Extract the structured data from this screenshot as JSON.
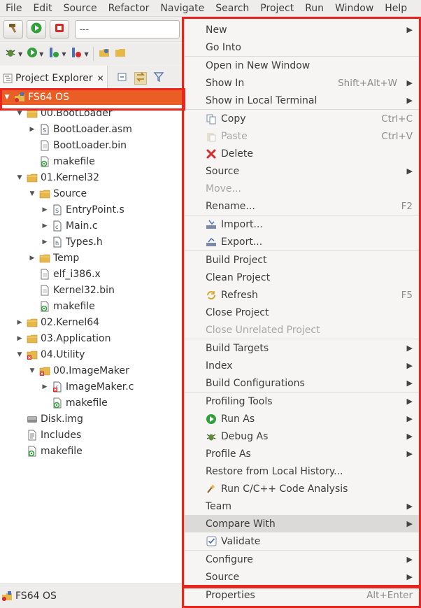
{
  "menubar": [
    "File",
    "Edit",
    "Source",
    "Refactor",
    "Navigate",
    "Search",
    "Project",
    "Run",
    "Window",
    "Help"
  ],
  "toolbar": {
    "config_combo": "---"
  },
  "explorer": {
    "tab_label": "Project Explorer",
    "tab_close": "✕",
    "tree": [
      {
        "label": "FS64 OS",
        "depth": 0,
        "toggle": "open",
        "icon": "project-icon",
        "selected": true
      },
      {
        "label": "00.BootLoader",
        "depth": 1,
        "toggle": "open",
        "icon": "folder-icon"
      },
      {
        "label": "BootLoader.asm",
        "depth": 2,
        "toggle": "closed",
        "icon": "asm-file-icon"
      },
      {
        "label": "BootLoader.bin",
        "depth": 2,
        "toggle": "none",
        "icon": "file-icon"
      },
      {
        "label": "makefile",
        "depth": 2,
        "toggle": "none",
        "icon": "makefile-icon"
      },
      {
        "label": "01.Kernel32",
        "depth": 1,
        "toggle": "open",
        "icon": "folder-icon"
      },
      {
        "label": "Source",
        "depth": 2,
        "toggle": "open",
        "icon": "folder-icon"
      },
      {
        "label": "EntryPoint.s",
        "depth": 3,
        "toggle": "closed",
        "icon": "asm-file-icon"
      },
      {
        "label": "Main.c",
        "depth": 3,
        "toggle": "closed",
        "icon": "c-file-icon"
      },
      {
        "label": "Types.h",
        "depth": 3,
        "toggle": "closed",
        "icon": "h-file-icon"
      },
      {
        "label": "Temp",
        "depth": 2,
        "toggle": "closed",
        "icon": "folder-icon"
      },
      {
        "label": "elf_i386.x",
        "depth": 2,
        "toggle": "none",
        "icon": "file-icon"
      },
      {
        "label": "Kernel32.bin",
        "depth": 2,
        "toggle": "none",
        "icon": "file-icon"
      },
      {
        "label": "makefile",
        "depth": 2,
        "toggle": "none",
        "icon": "makefile-icon"
      },
      {
        "label": "02.Kernel64",
        "depth": 1,
        "toggle": "closed",
        "icon": "folder-icon"
      },
      {
        "label": "03.Application",
        "depth": 1,
        "toggle": "closed",
        "icon": "folder-icon"
      },
      {
        "label": "04.Utility",
        "depth": 1,
        "toggle": "open",
        "icon": "folder-error-icon"
      },
      {
        "label": "00.ImageMaker",
        "depth": 2,
        "toggle": "open",
        "icon": "folder-error-icon"
      },
      {
        "label": "ImageMaker.c",
        "depth": 3,
        "toggle": "closed",
        "icon": "c-file-error-icon"
      },
      {
        "label": "makefile",
        "depth": 3,
        "toggle": "none",
        "icon": "makefile-icon"
      },
      {
        "label": "Disk.img",
        "depth": 1,
        "toggle": "none",
        "icon": "disk-icon"
      },
      {
        "label": "Includes",
        "depth": 1,
        "toggle": "none",
        "icon": "includes-icon"
      },
      {
        "label": "makefile",
        "depth": 1,
        "toggle": "none",
        "icon": "makefile-icon"
      }
    ]
  },
  "status": {
    "label": "FS64 OS"
  },
  "context_menu": {
    "items": [
      {
        "label": "New",
        "submenu": true
      },
      {
        "label": "Go Into"
      },
      {
        "sep": true
      },
      {
        "label": "Open in New Window"
      },
      {
        "label": "Show In",
        "shortcut": "Shift+Alt+W",
        "submenu": true
      },
      {
        "label": "Show in Local Terminal",
        "submenu": true
      },
      {
        "sep": true
      },
      {
        "label": "Copy",
        "shortcut": "Ctrl+C",
        "icon": "copy-icon"
      },
      {
        "label": "Paste",
        "shortcut": "Ctrl+V",
        "icon": "paste-icon",
        "disabled": true
      },
      {
        "label": "Delete",
        "icon": "delete-icon"
      },
      {
        "label": "Source",
        "submenu": true
      },
      {
        "label": "Move...",
        "disabled": true
      },
      {
        "label": "Rename...",
        "shortcut": "F2"
      },
      {
        "sep": true
      },
      {
        "label": "Import...",
        "icon": "import-icon"
      },
      {
        "label": "Export...",
        "icon": "export-icon"
      },
      {
        "sep": true
      },
      {
        "label": "Build Project"
      },
      {
        "label": "Clean Project"
      },
      {
        "label": "Refresh",
        "shortcut": "F5",
        "icon": "refresh-icon"
      },
      {
        "label": "Close Project"
      },
      {
        "label": "Close Unrelated Project",
        "disabled": true
      },
      {
        "sep": true
      },
      {
        "label": "Build Targets",
        "submenu": true
      },
      {
        "label": "Index",
        "submenu": true
      },
      {
        "label": "Build Configurations",
        "submenu": true
      },
      {
        "sep": true
      },
      {
        "label": "Profiling Tools",
        "submenu": true
      },
      {
        "label": "Run As",
        "submenu": true,
        "icon": "run-icon"
      },
      {
        "label": "Debug As",
        "submenu": true,
        "icon": "debug-icon"
      },
      {
        "label": "Profile As",
        "submenu": true
      },
      {
        "label": "Restore from Local History..."
      },
      {
        "label": "Run C/C++ Code Analysis",
        "icon": "code-analysis-icon"
      },
      {
        "label": "Team",
        "submenu": true
      },
      {
        "label": "Compare With",
        "submenu": true,
        "highlighted": true
      },
      {
        "label": "Validate",
        "icon": "checkbox-checked-icon"
      },
      {
        "sep": true
      },
      {
        "label": "Configure",
        "submenu": true
      },
      {
        "label": "Source",
        "submenu": true
      },
      {
        "sep": true
      },
      {
        "label": "Properties",
        "shortcut": "Alt+Enter"
      }
    ]
  },
  "colors": {
    "selection": "#e95e24",
    "annotation": "#e8261e",
    "menu_bg": "#f6f5f4"
  }
}
